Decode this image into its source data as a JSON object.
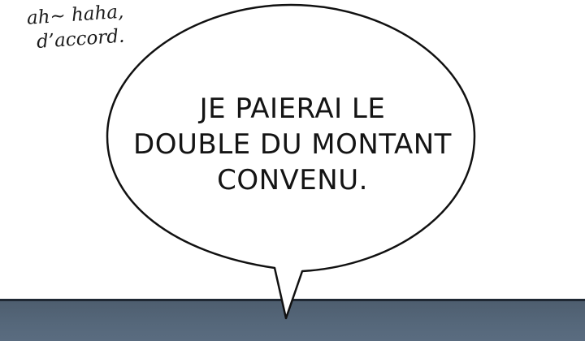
{
  "panel": {
    "handwritten_note": {
      "line1": "ah~ haha,",
      "line2": "d’accord."
    },
    "speech_bubble": {
      "lines": [
        "JE PAIERAI LE",
        "DOUBLE DU MONTANT",
        "CONVENU."
      ]
    }
  },
  "colors": {
    "background": "#ffffff",
    "bubble_fill": "#ffffff",
    "bubble_outline": "#111111",
    "lower_panel": "#55677a",
    "text": "#141414"
  }
}
